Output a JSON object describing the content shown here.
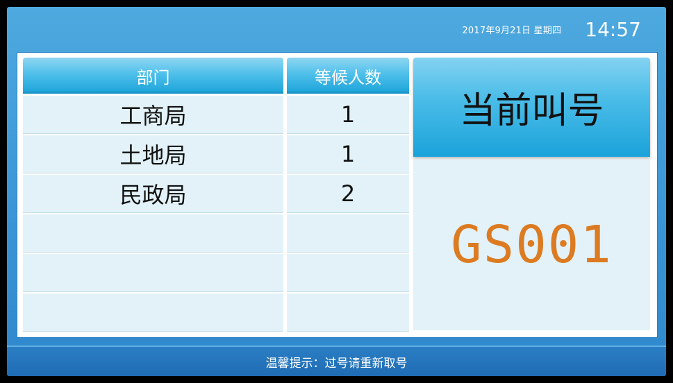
{
  "header": {
    "date": "2017年9月21日 星期四",
    "time": "14:57"
  },
  "table": {
    "columns": [
      "部门",
      "等候人数"
    ],
    "rows": [
      {
        "dept": "工商局",
        "waiting": "1"
      },
      {
        "dept": "土地局",
        "waiting": "1"
      },
      {
        "dept": "民政局",
        "waiting": "2"
      },
      {
        "dept": "",
        "waiting": ""
      },
      {
        "dept": "",
        "waiting": ""
      },
      {
        "dept": "",
        "waiting": ""
      }
    ]
  },
  "call": {
    "title": "当前叫号",
    "number": "GS001"
  },
  "footer": {
    "notice": "温馨提示：过号请重新取号"
  },
  "colors": {
    "background_blue": "#3a96d6",
    "header_cyan": "#4fc0ea",
    "cell_bg": "#e2f2f8",
    "call_number": "#dc7b22"
  }
}
